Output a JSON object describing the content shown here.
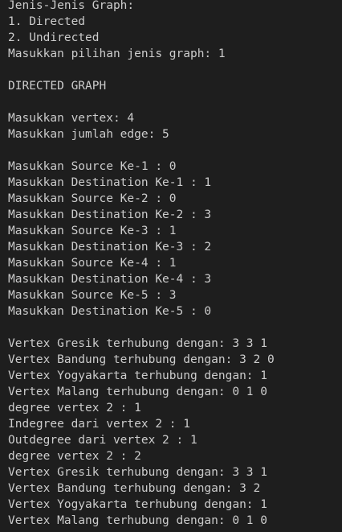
{
  "terminal": {
    "lines": [
      "Jenis-Jenis Graph:",
      "1. Directed",
      "2. Undirected",
      "Masukkan pilihan jenis graph: 1",
      "",
      "DIRECTED GRAPH",
      "",
      "Masukkan vertex: 4",
      "Masukkan jumlah edge: 5",
      "",
      "Masukkan Source Ke-1 : 0",
      "Masukkan Destination Ke-1 : 1",
      "Masukkan Source Ke-2 : 0",
      "Masukkan Destination Ke-2 : 3",
      "Masukkan Source Ke-3 : 1",
      "Masukkan Destination Ke-3 : 2",
      "Masukkan Source Ke-4 : 1",
      "Masukkan Destination Ke-4 : 3",
      "Masukkan Source Ke-5 : 3",
      "Masukkan Destination Ke-5 : 0",
      "",
      "Vertex Gresik terhubung dengan: 3 3 1",
      "Vertex Bandung terhubung dengan: 3 2 0",
      "Vertex Yogyakarta terhubung dengan: 1",
      "Vertex Malang terhubung dengan: 0 1 0",
      "degree vertex 2 : 1",
      "Indegree dari vertex 2 : 1",
      "Outdegree dari vertex 2 : 1",
      "degree vertex 2 : 2",
      "Vertex Gresik terhubung dengan: 3 3 1",
      "Vertex Bandung terhubung dengan: 3 2",
      "Vertex Yogyakarta terhubung dengan: 1",
      "Vertex Malang terhubung dengan: 0 1 0"
    ]
  },
  "colors": {
    "background": "#1e1e1e",
    "text": "#cccccc"
  }
}
